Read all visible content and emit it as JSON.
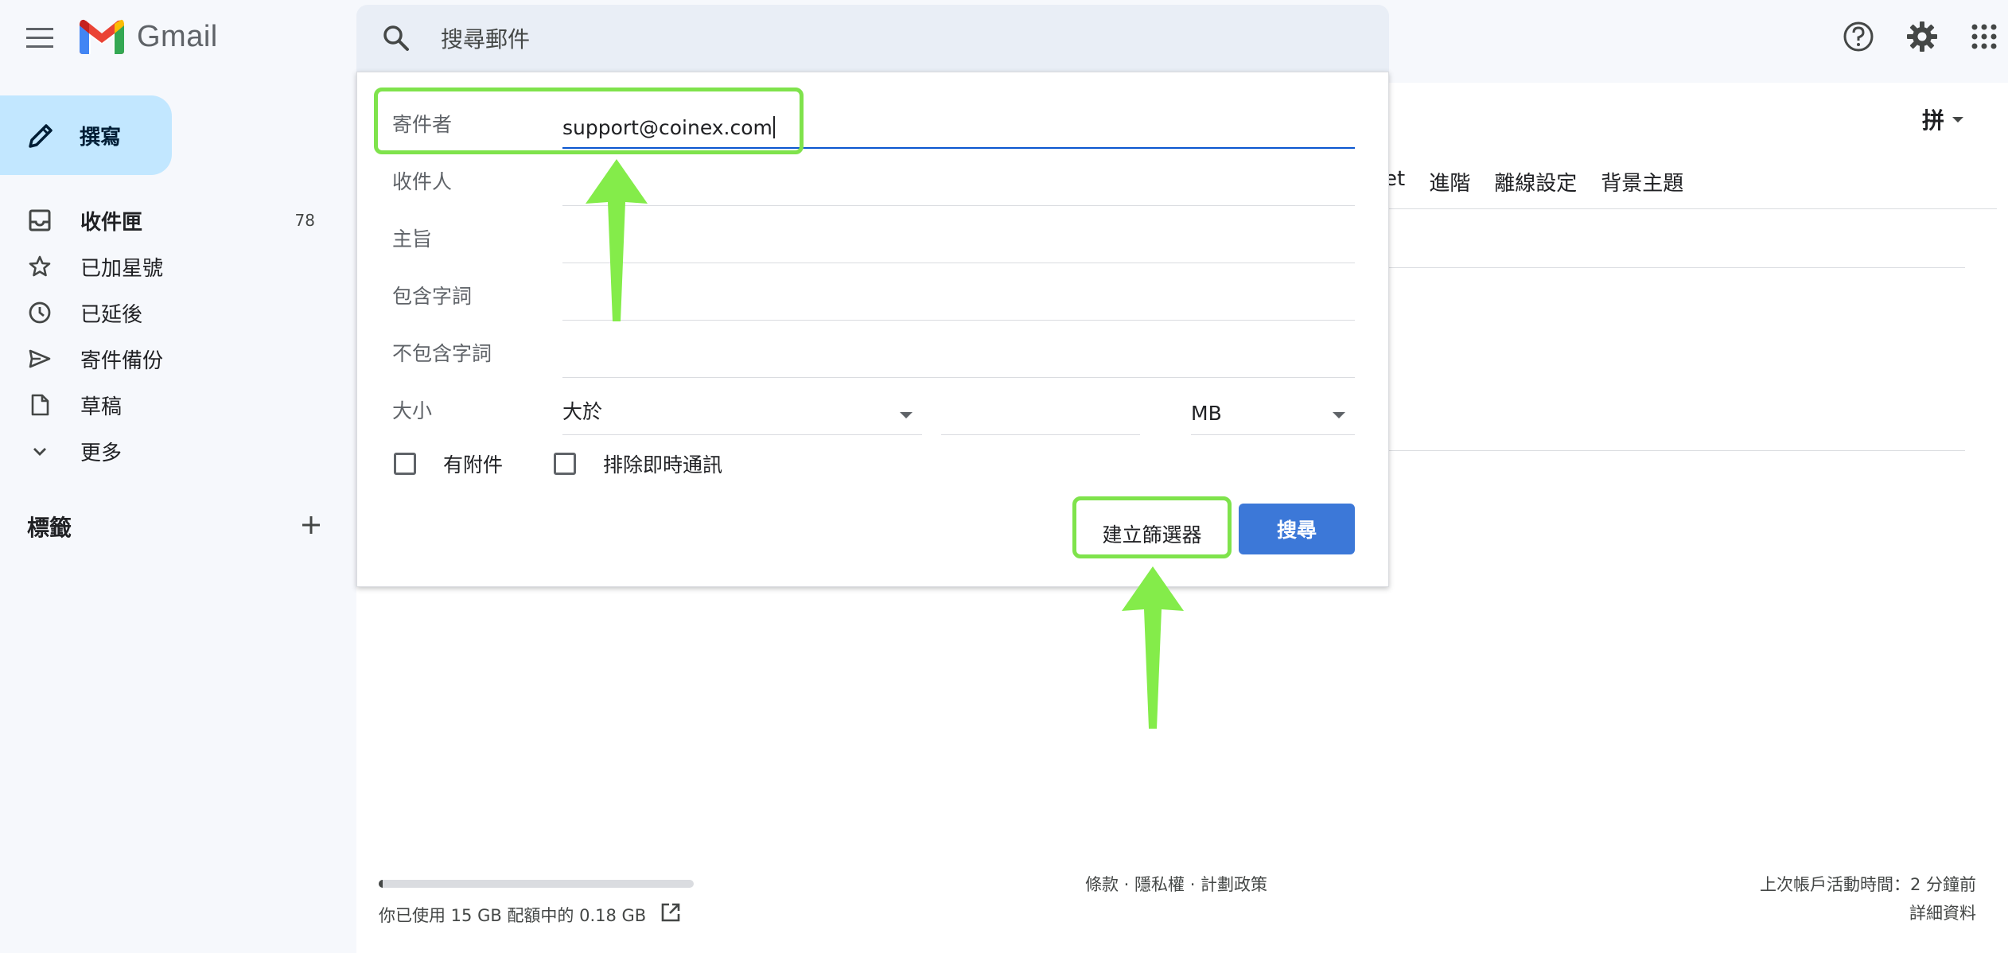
{
  "app": {
    "name": "Gmail"
  },
  "search": {
    "placeholder": "搜尋郵件"
  },
  "sidebar": {
    "compose_label": "撰寫",
    "items": [
      {
        "label": "收件匣",
        "count": "78",
        "icon": "inbox-icon"
      },
      {
        "label": "已加星號",
        "icon": "star-icon"
      },
      {
        "label": "已延後",
        "icon": "clock-icon"
      },
      {
        "label": "寄件備份",
        "icon": "send-icon"
      },
      {
        "label": "草稿",
        "icon": "draft-icon"
      },
      {
        "label": "更多",
        "icon": "chevron-down-icon"
      }
    ],
    "labels_title": "標籤"
  },
  "background": {
    "language_button": "拼",
    "settings_tabs": [
      "et",
      "進階",
      "離線設定",
      "背景主題"
    ]
  },
  "advanced_search": {
    "fields": {
      "from_label": "寄件者",
      "from_value": "support@coinex.com",
      "to_label": "收件人",
      "subject_label": "主旨",
      "has_words_label": "包含字詞",
      "not_words_label": "不包含字詞",
      "size_label": "大小"
    },
    "size_operator": "大於",
    "size_unit": "MB",
    "has_attachment_label": "有附件",
    "exclude_chats_label": "排除即時通訊",
    "create_filter_label": "建立篩選器",
    "search_button_label": "搜尋"
  },
  "footer": {
    "storage_text": "你已使用 15 GB 配額中的 0.18 GB",
    "storage_used_fraction": 0.012,
    "links": "條款 · 隱私權 · 計劃政策",
    "last_activity": "上次帳戶活動時間：2 分鐘前",
    "details": "詳細資料"
  },
  "colors": {
    "highlight": "#7fe34c",
    "primary_button": "#3c78d8",
    "compose_bg": "#c2e7ff"
  }
}
